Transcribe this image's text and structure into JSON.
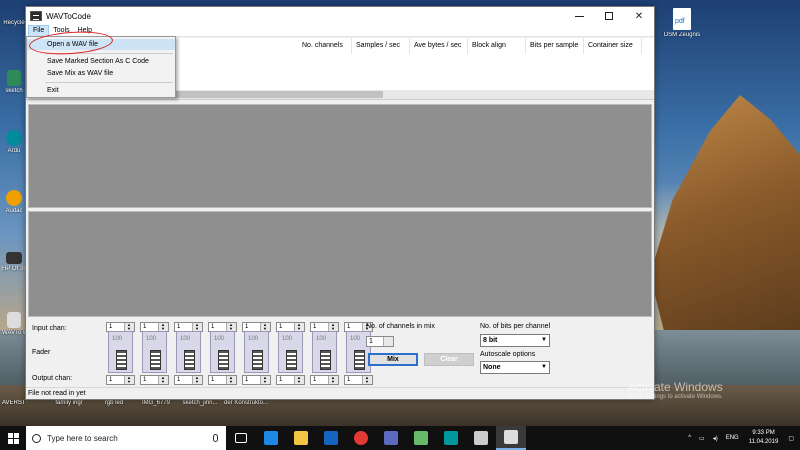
{
  "desktop": {
    "icons_left": [
      {
        "label": "Recycle",
        "color": "#9bb7d4"
      },
      {
        "label": "sketch",
        "color": "#2e8b57"
      },
      {
        "label": "Ardu",
        "color": "#008c9a"
      },
      {
        "label": "Audac",
        "color": "#f0a000"
      },
      {
        "label": "HP Of 3830",
        "color": "#333333"
      },
      {
        "label": "WAVTo wi",
        "color": "#dddddd"
      },
      {
        "label": "AVERSTO",
        "color": "#cccccc"
      }
    ],
    "icons_right": [
      {
        "label": "DSM Zeugnis",
        "color": "#ffffff"
      }
    ],
    "icons_bottom": [
      "family ingr",
      "rgb led",
      "IMG_6779",
      "sketch_jinn...",
      "der Konstrukto..."
    ]
  },
  "window": {
    "title": "WAVToCode",
    "controls": {
      "close": "✕"
    },
    "menu": [
      "File",
      "Tools",
      "Help"
    ],
    "file_menu": {
      "items": [
        "Open a WAV file",
        "Save Marked Section As C Code",
        "Save Mix as WAV file",
        "Exit"
      ]
    },
    "header_columns": [
      "No. channels",
      "Samples / sec",
      "Ave bytes / sec",
      "Block align",
      "Bits per sample",
      "Container size"
    ],
    "mixer": {
      "input_label": "Input chan:",
      "fader_label": "Fader",
      "output_label": "Output chan:",
      "channels": [
        {
          "input": "1",
          "level": "100",
          "output": "1"
        },
        {
          "input": "1",
          "level": "100",
          "output": "1"
        },
        {
          "input": "1",
          "level": "100",
          "output": "1"
        },
        {
          "input": "1",
          "level": "100",
          "output": "1"
        },
        {
          "input": "1",
          "level": "100",
          "output": "1"
        },
        {
          "input": "1",
          "level": "100",
          "output": "1"
        },
        {
          "input": "1",
          "level": "100",
          "output": "1"
        },
        {
          "input": "1",
          "level": "100",
          "output": "1"
        }
      ],
      "channels_in_mix_label": "No. of channels in mix",
      "channels_in_mix_value": "1",
      "mix_button": "Mix",
      "clear_button": "Clear",
      "bits_label": "No. of bits per channel",
      "bits_value": "8 bit",
      "autoscale_label": "Autoscale options",
      "autoscale_value": "None"
    },
    "status": "File not read in yet"
  },
  "watermark": {
    "title": "Activate Windows",
    "subtitle": "Go to Settings to activate Windows."
  },
  "taskbar": {
    "search_placeholder": "Type here to search",
    "apps": [
      {
        "name": "task-view-icon",
        "color": "#ffffff"
      },
      {
        "name": "edge-icon",
        "color": "#1e88e5"
      },
      {
        "name": "file-explorer-icon",
        "color": "#f4c542"
      },
      {
        "name": "edge-icon-2",
        "color": "#1565c0"
      },
      {
        "name": "chrome-icon",
        "color": "#e53935"
      },
      {
        "name": "store-icon",
        "color": "#5c6bc0"
      },
      {
        "name": "android-studio-icon",
        "color": "#66bb6a"
      },
      {
        "name": "arduino-icon",
        "color": "#00979d"
      },
      {
        "name": "calculator-icon",
        "color": "#cccccc"
      },
      {
        "name": "wavtocode-icon",
        "color": "#dddddd"
      }
    ],
    "tray": {
      "language": "ENG",
      "time": "9:33 PM",
      "date": "11.04.2019"
    }
  }
}
